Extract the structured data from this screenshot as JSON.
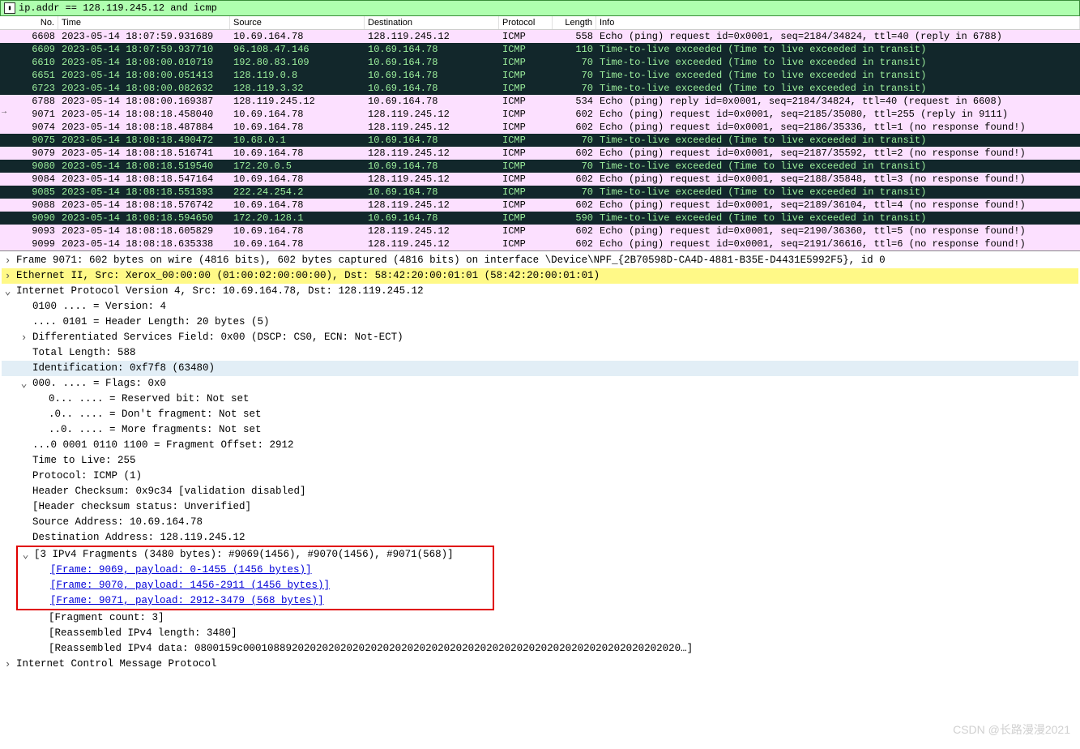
{
  "filter": {
    "expression": "ip.addr == 128.119.245.12 and icmp"
  },
  "columns": {
    "no": "No.",
    "time": "Time",
    "source": "Source",
    "destination": "Destination",
    "protocol": "Protocol",
    "length": "Length",
    "info": "Info"
  },
  "packets": [
    {
      "no": "6608",
      "time": "2023-05-14 18:07:59.931689",
      "src": "10.69.164.78",
      "dst": "128.119.245.12",
      "proto": "ICMP",
      "len": "558",
      "info": "Echo (ping) request  id=0x0001, seq=2184/34824, ttl=40 (reply in 6788)",
      "cls": "pink"
    },
    {
      "no": "6609",
      "time": "2023-05-14 18:07:59.937710",
      "src": "96.108.47.146",
      "dst": "10.69.164.78",
      "proto": "ICMP",
      "len": "110",
      "info": "Time-to-live exceeded (Time to live exceeded in transit)",
      "cls": "black"
    },
    {
      "no": "6610",
      "time": "2023-05-14 18:08:00.010719",
      "src": "192.80.83.109",
      "dst": "10.69.164.78",
      "proto": "ICMP",
      "len": "70",
      "info": "Time-to-live exceeded (Time to live exceeded in transit)",
      "cls": "black"
    },
    {
      "no": "6651",
      "time": "2023-05-14 18:08:00.051413",
      "src": "128.119.0.8",
      "dst": "10.69.164.78",
      "proto": "ICMP",
      "len": "70",
      "info": "Time-to-live exceeded (Time to live exceeded in transit)",
      "cls": "black"
    },
    {
      "no": "6723",
      "time": "2023-05-14 18:08:00.082632",
      "src": "128.119.3.32",
      "dst": "10.69.164.78",
      "proto": "ICMP",
      "len": "70",
      "info": "Time-to-live exceeded (Time to live exceeded in transit)",
      "cls": "black"
    },
    {
      "no": "6788",
      "time": "2023-05-14 18:08:00.169387",
      "src": "128.119.245.12",
      "dst": "10.69.164.78",
      "proto": "ICMP",
      "len": "534",
      "info": "Echo (ping) reply    id=0x0001, seq=2184/34824, ttl=40 (request in 6608)",
      "cls": "pink"
    },
    {
      "no": "9071",
      "time": "2023-05-14 18:08:18.458040",
      "src": "10.69.164.78",
      "dst": "128.119.245.12",
      "proto": "ICMP",
      "len": "602",
      "info": "Echo (ping) request  id=0x0001, seq=2185/35080, ttl=255 (reply in 9111)",
      "cls": "pink",
      "sel": true
    },
    {
      "no": "9074",
      "time": "2023-05-14 18:08:18.487884",
      "src": "10.69.164.78",
      "dst": "128.119.245.12",
      "proto": "ICMP",
      "len": "602",
      "info": "Echo (ping) request  id=0x0001, seq=2186/35336, ttl=1 (no response found!)",
      "cls": "pink"
    },
    {
      "no": "9075",
      "time": "2023-05-14 18:08:18.490472",
      "src": "10.68.0.1",
      "dst": "10.69.164.78",
      "proto": "ICMP",
      "len": "70",
      "info": "Time-to-live exceeded (Time to live exceeded in transit)",
      "cls": "black"
    },
    {
      "no": "9079",
      "time": "2023-05-14 18:08:18.516741",
      "src": "10.69.164.78",
      "dst": "128.119.245.12",
      "proto": "ICMP",
      "len": "602",
      "info": "Echo (ping) request  id=0x0001, seq=2187/35592, ttl=2 (no response found!)",
      "cls": "pink"
    },
    {
      "no": "9080",
      "time": "2023-05-14 18:08:18.519540",
      "src": "172.20.0.5",
      "dst": "10.69.164.78",
      "proto": "ICMP",
      "len": "70",
      "info": "Time-to-live exceeded (Time to live exceeded in transit)",
      "cls": "black"
    },
    {
      "no": "9084",
      "time": "2023-05-14 18:08:18.547164",
      "src": "10.69.164.78",
      "dst": "128.119.245.12",
      "proto": "ICMP",
      "len": "602",
      "info": "Echo (ping) request  id=0x0001, seq=2188/35848, ttl=3 (no response found!)",
      "cls": "pink"
    },
    {
      "no": "9085",
      "time": "2023-05-14 18:08:18.551393",
      "src": "222.24.254.2",
      "dst": "10.69.164.78",
      "proto": "ICMP",
      "len": "70",
      "info": "Time-to-live exceeded (Time to live exceeded in transit)",
      "cls": "black"
    },
    {
      "no": "9088",
      "time": "2023-05-14 18:08:18.576742",
      "src": "10.69.164.78",
      "dst": "128.119.245.12",
      "proto": "ICMP",
      "len": "602",
      "info": "Echo (ping) request  id=0x0001, seq=2189/36104, ttl=4 (no response found!)",
      "cls": "pink"
    },
    {
      "no": "9090",
      "time": "2023-05-14 18:08:18.594650",
      "src": "172.20.128.1",
      "dst": "10.69.164.78",
      "proto": "ICMP",
      "len": "590",
      "info": "Time-to-live exceeded (Time to live exceeded in transit)",
      "cls": "black"
    },
    {
      "no": "9093",
      "time": "2023-05-14 18:08:18.605829",
      "src": "10.69.164.78",
      "dst": "128.119.245.12",
      "proto": "ICMP",
      "len": "602",
      "info": "Echo (ping) request  id=0x0001, seq=2190/36360, ttl=5 (no response found!)",
      "cls": "pink"
    },
    {
      "no": "9099",
      "time": "2023-05-14 18:08:18.635338",
      "src": "10.69.164.78",
      "dst": "128.119.245.12",
      "proto": "ICMP",
      "len": "602",
      "info": "Echo (ping) request  id=0x0001, seq=2191/36616, ttl=6 (no response found!)",
      "cls": "pink"
    }
  ],
  "details": {
    "frame": "Frame 9071: 602 bytes on wire (4816 bits), 602 bytes captured (4816 bits) on interface \\Device\\NPF_{2B70598D-CA4D-4881-B35E-D4431E5992F5}, id 0",
    "eth": "Ethernet II, Src: Xerox_00:00:00 (01:00:02:00:00:00), Dst: 58:42:20:00:01:01 (58:42:20:00:01:01)",
    "ip_header": "Internet Protocol Version 4, Src: 10.69.164.78, Dst: 128.119.245.12",
    "ip_version": "0100 .... = Version: 4",
    "ip_hlen": ".... 0101 = Header Length: 20 bytes (5)",
    "ip_dsf": "Differentiated Services Field: 0x00 (DSCP: CS0, ECN: Not-ECT)",
    "ip_tlen": "Total Length: 588",
    "ip_id": "Identification: 0xf7f8 (63480)",
    "ip_flags": "000. .... = Flags: 0x0",
    "ip_flag_r": "0... .... = Reserved bit: Not set",
    "ip_flag_df": ".0.. .... = Don't fragment: Not set",
    "ip_flag_mf": "..0. .... = More fragments: Not set",
    "ip_fo": "...0 0001 0110 1100 = Fragment Offset: 2912",
    "ip_ttl": "Time to Live: 255",
    "ip_proto": "Protocol: ICMP (1)",
    "ip_chk": "Header Checksum: 0x9c34 [validation disabled]",
    "ip_chks": "[Header checksum status: Unverified]",
    "ip_src": "Source Address: 10.69.164.78",
    "ip_dst": "Destination Address: 128.119.245.12",
    "frags_hdr": "[3 IPv4 Fragments (3480 bytes): #9069(1456), #9070(1456), #9071(568)]",
    "frag1": "[Frame: 9069, payload: 0-1455 (1456 bytes)]",
    "frag2": "[Frame: 9070, payload: 1456-2911 (1456 bytes)]",
    "frag3": "[Frame: 9071, payload: 2912-3479 (568 bytes)]",
    "fcount": "[Fragment count: 3]",
    "riplen": "[Reassembled IPv4 length: 3480]",
    "ripdata": "[Reassembled IPv4 data: 0800159c000108892020202020202020202020202020202020202020202020202020202020202020…]",
    "icmp": "Internet Control Message Protocol"
  },
  "watermark": "CSDN @长路漫漫2021"
}
